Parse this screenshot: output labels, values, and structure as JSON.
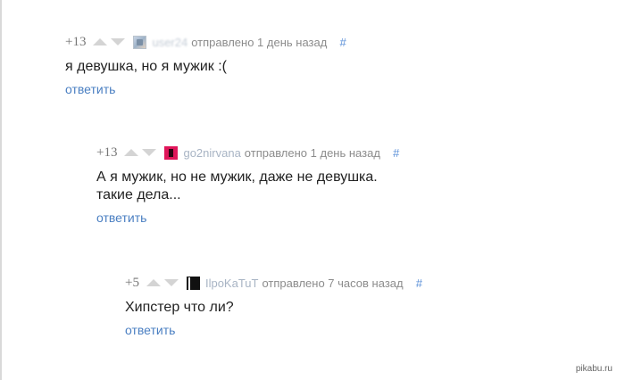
{
  "comments": [
    {
      "rating": "+13",
      "author": "user24",
      "posted": "отправлено 1 день назад",
      "hash": "#",
      "avatar_icon": "user-avatar-icon",
      "text": "я девушка, но я мужик :(",
      "reply_label": "ответить"
    },
    {
      "rating": "+13",
      "author": "go2nirvana",
      "posted": "отправлено 1 день назад",
      "hash": "#",
      "avatar_icon": "user-avatar-icon",
      "text": "А я мужик, но не мужик, даже не девушка.\nтакие дела...",
      "reply_label": "ответить"
    },
    {
      "rating": "+5",
      "author": "IlpoKaTuT",
      "posted": "отправлено 7 часов назад",
      "hash": "#",
      "avatar_icon": "user-avatar-icon",
      "text": "Хипстер что ли?",
      "reply_label": "ответить"
    }
  ],
  "vote_icons": {
    "up": "upvote-arrow-icon",
    "down": "downvote-arrow-icon"
  },
  "watermark": "pikabu.ru",
  "colors": {
    "link": "#4a7fc2",
    "meta": "#8c8c8c",
    "arrow": "#d4d4d4"
  }
}
